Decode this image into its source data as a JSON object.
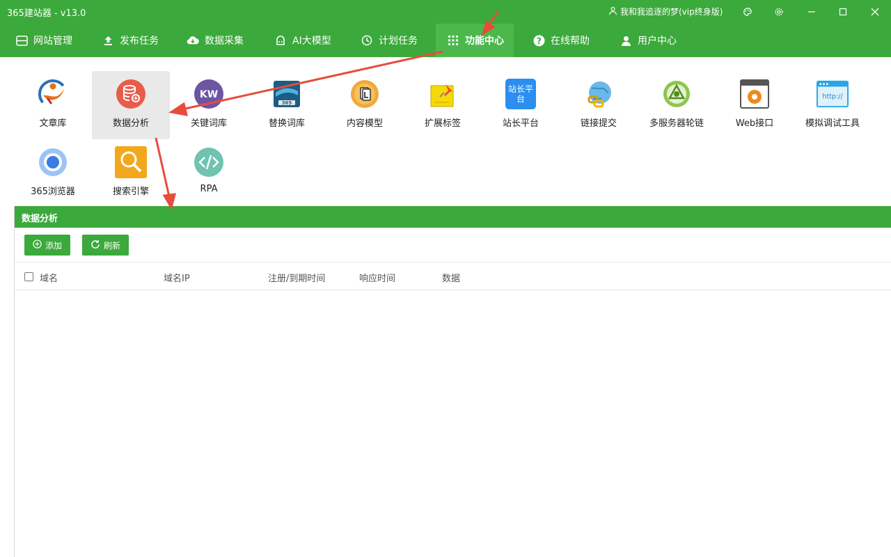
{
  "window": {
    "title": "365建站器 - v13.0",
    "user": "我和我追逐的梦(vip终身版)"
  },
  "nav": [
    {
      "label": "网站管理",
      "icon": "window-icon"
    },
    {
      "label": "发布任务",
      "icon": "upload-icon"
    },
    {
      "label": "数据采集",
      "icon": "cloud-download-icon"
    },
    {
      "label": "AI大模型",
      "icon": "robot-icon"
    },
    {
      "label": "计划任务",
      "icon": "clock-icon"
    },
    {
      "label": "功能中心",
      "icon": "grid-icon",
      "active": true
    },
    {
      "label": "在线帮助",
      "icon": "help-icon"
    },
    {
      "label": "用户中心",
      "icon": "person-icon"
    }
  ],
  "functions": [
    {
      "label": "文章库"
    },
    {
      "label": "数据分析",
      "selected": true
    },
    {
      "label": "关键词库",
      "icon_text": "KW"
    },
    {
      "label": "替换词库",
      "icon_text": "365"
    },
    {
      "label": "内容模型"
    },
    {
      "label": "扩展标签"
    },
    {
      "label": "站长平台",
      "icon_text": "站长平台"
    },
    {
      "label": "链接提交"
    },
    {
      "label": "多服务器轮链"
    },
    {
      "label": "Web接口"
    },
    {
      "label": "模拟调试工具",
      "icon_text": "http://"
    },
    {
      "label": "365浏览器"
    },
    {
      "label": "搜索引擎"
    },
    {
      "label": "RPA"
    }
  ],
  "panel": {
    "title": "数据分析",
    "add_label": "添加",
    "refresh_label": "刷新",
    "columns": [
      "域名",
      "域名IP",
      "注册/到期时间",
      "响应时间",
      "数据"
    ]
  },
  "colors": {
    "brand_green": "#3ba93b",
    "active_green": "#4cb84c",
    "annotation_red": "#e74c3c"
  }
}
